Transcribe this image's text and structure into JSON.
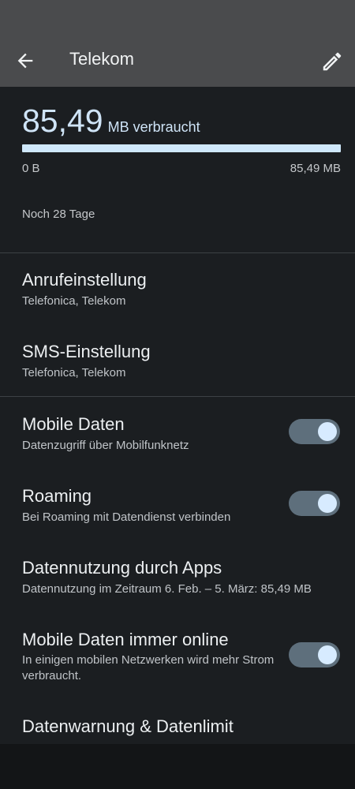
{
  "app_bar": {
    "title": "Telekom"
  },
  "usage": {
    "amount": "85,49",
    "unit_label": "MB verbraucht",
    "progress_fraction": 1.0,
    "range_min": "0 B",
    "range_max": "85,49 MB",
    "remaining": "Noch 28 Tage"
  },
  "settings": [
    {
      "title": "Anrufeinstellung",
      "subtitle": "Telefonica, Telekom"
    },
    {
      "title": "SMS-Einstellung",
      "subtitle": "Telefonica, Telekom"
    },
    {
      "title": "Mobile Daten",
      "subtitle": "Datenzugriff über Mobilfunknetz",
      "toggle": true
    },
    {
      "title": "Roaming",
      "subtitle": "Bei Roaming mit Datendienst verbinden",
      "toggle": true
    },
    {
      "title": "Datennutzung durch Apps",
      "subtitle": "Datennutzung im Zeitraum 6. Feb. – 5. März: 85,49 MB"
    },
    {
      "title": "Mobile Daten immer online",
      "subtitle": "In einigen mobilen Netzwerken wird mehr Strom verbraucht.",
      "toggle": true
    },
    {
      "title": "Datenwarnung & Datenlimit"
    }
  ],
  "colors": {
    "accent": "#cfe4f7",
    "background": "#1b1e21",
    "app_bar": "#4a4b4d",
    "toggle_track": "#5e6f7c",
    "toggle_knob": "#d7ebff"
  },
  "icons": {
    "back": "arrow-back-icon",
    "edit": "pencil-icon"
  }
}
